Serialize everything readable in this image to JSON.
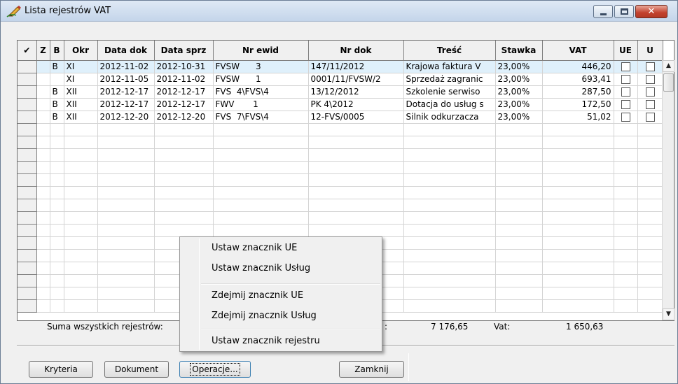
{
  "window": {
    "title": "Lista rejestrów VAT",
    "close_glyph": "✕"
  },
  "grid": {
    "headers": {
      "check": "✔",
      "z": "Z",
      "b": "B",
      "okr": "Okr",
      "data_dok": "Data dok",
      "data_sprz": "Data sprz",
      "nr_ewid": "Nr ewid",
      "nr_dok": "Nr dok",
      "tresc": "Treść",
      "stawka": "Stawka",
      "vat": "VAT",
      "ue": "UE",
      "u": "U"
    },
    "rows": [
      {
        "z": "",
        "b": "B",
        "okr": "XI",
        "data_dok": "2012-11-02",
        "data_sprz": "2012-10-31",
        "nr_ewid": "FVSW      3",
        "nr_dok": "147/11/2012",
        "tresc": "Krajowa faktura V",
        "stawka": "23,00%",
        "vat": "446,20"
      },
      {
        "z": "",
        "b": "",
        "okr": "XI",
        "data_dok": "2012-11-05",
        "data_sprz": "2012-11-02",
        "nr_ewid": "FVSW      1",
        "nr_dok": "0001/11/FVSW/2",
        "tresc": "Sprzedaż zagranic",
        "stawka": "23,00%",
        "vat": "693,41"
      },
      {
        "z": "",
        "b": "B",
        "okr": "XII",
        "data_dok": "2012-12-17",
        "data_sprz": "2012-12-17",
        "nr_ewid": "FVS  4\\FVS\\4",
        "nr_dok": "13/12/2012",
        "tresc": "Szkolenie serwiso",
        "stawka": "23,00%",
        "vat": "287,50"
      },
      {
        "z": "",
        "b": "B",
        "okr": "XII",
        "data_dok": "2012-12-17",
        "data_sprz": "2012-12-17",
        "nr_ewid": "FWV       1",
        "nr_dok": "PK 4\\2012",
        "tresc": "Dotacja do usług s",
        "stawka": "23,00%",
        "vat": "172,50"
      },
      {
        "z": "",
        "b": "B",
        "okr": "XII",
        "data_dok": "2012-12-20",
        "data_sprz": "2012-12-20",
        "nr_ewid": "FVS  7\\FVS\\4",
        "nr_dok": "12-FVS/0005",
        "tresc": "Silnik odkurzacza",
        "stawka": "23,00%",
        "vat": "51,02"
      }
    ]
  },
  "scrollbar": {
    "up": "▲",
    "down": "▼"
  },
  "summary": {
    "label": "Suma wszystkich rejestrów:",
    "colon": ":",
    "netto": "7 176,65",
    "vat_label": "Vat:",
    "vat": "1 650,63"
  },
  "context_menu": {
    "items": [
      "Ustaw znacznik UE",
      "Ustaw znacznik Usług",
      "Zdejmij znacznik UE",
      "Zdejmij znacznik Usług",
      "Ustaw znacznik rejestru"
    ]
  },
  "buttons": {
    "kryteria": "Kryteria",
    "dokument": "Dokument",
    "operacje": "Operacje...",
    "zamknij": "Zamknij"
  }
}
